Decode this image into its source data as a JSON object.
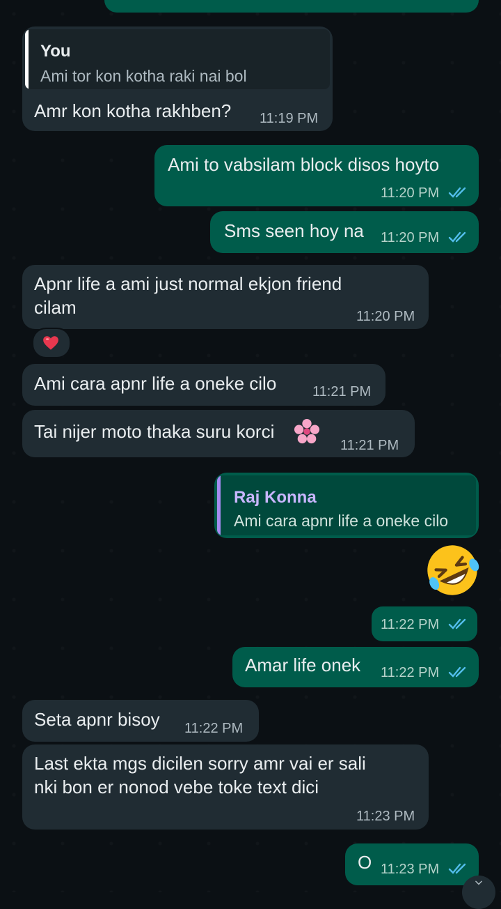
{
  "colors": {
    "incoming_bubble": "#202c33",
    "outgoing_bubble": "#005c4b",
    "read_ticks": "#53bdeb",
    "you_quote_bar": "#ffffff",
    "raj_quote_bar": "#a68cf2"
  },
  "messages": {
    "m1": {
      "quote_name": "You",
      "quote_text": "Ami tor kon kotha raki nai bol",
      "text": "Amr kon kotha rakhben?",
      "time": "11:19 PM"
    },
    "m2": {
      "text": "Ami to vabsilam block disos hoyto",
      "time": "11:20 PM"
    },
    "m3": {
      "text": "Sms seen hoy na",
      "time": "11:20 PM"
    },
    "m4": {
      "text_line1": "Apnr life a ami just normal ekjon friend",
      "text_line2": "cilam",
      "time": "11:20 PM",
      "reaction": "heart-emoji"
    },
    "m5": {
      "text": "Ami cara apnr life a oneke cilo",
      "time": "11:21 PM"
    },
    "m6": {
      "text": "Tai nijer moto thaka suru korci",
      "emoji": "cherry-blossom-emoji",
      "time": "11:21 PM"
    },
    "m7": {
      "quote_name": "Raj Konna",
      "quote_text": "Ami cara apnr life a oneke cilo",
      "sticker": "rolling-on-floor-laughing-emoji",
      "time": "11:22 PM"
    },
    "m8": {
      "text": "Amar life onek",
      "time": "11:22 PM"
    },
    "m9": {
      "text": "Seta apnr bisoy",
      "time": "11:22 PM"
    },
    "m10": {
      "text_line1": "Last ekta mgs dicilen sorry amr vai er sali",
      "text_line2": "nki bon er nonod vebe toke text dici",
      "time": "11:23 PM"
    },
    "m11": {
      "text": "O",
      "time": "11:23 PM"
    }
  }
}
